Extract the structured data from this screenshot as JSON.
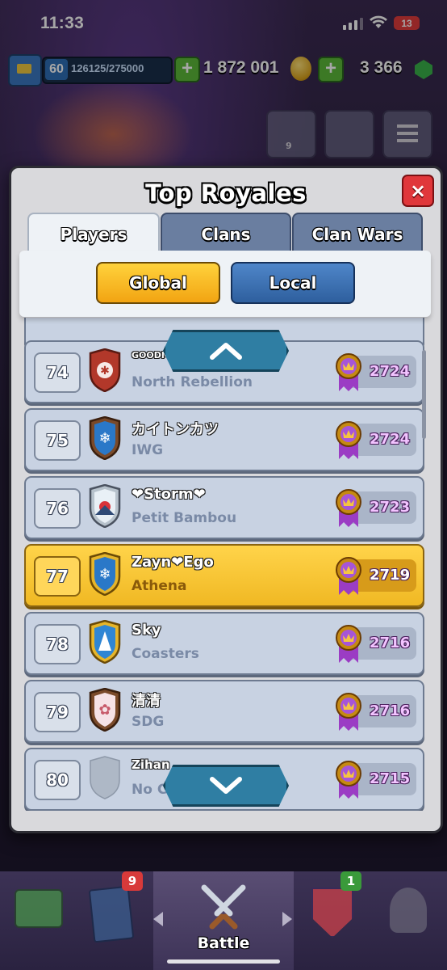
{
  "status_bar": {
    "time": "11:33",
    "battery": "13"
  },
  "resources": {
    "level": "60",
    "xp_progress": "126125/275000",
    "gold": "1 872 001",
    "gems": "3 366"
  },
  "menu": {
    "friends_count": "9"
  },
  "modal": {
    "title": "Top Royales",
    "close_label": "×",
    "tabs": [
      {
        "label": "Players",
        "active": true
      },
      {
        "label": "Clans",
        "active": false
      },
      {
        "label": "Clan Wars",
        "active": false
      }
    ],
    "toggles": {
      "global": "Global",
      "local": "Local",
      "selected": "Global"
    },
    "scroll_up": "⌃",
    "scroll_down": "⌄"
  },
  "leaderboard": [
    {
      "rank": "74",
      "name": "GOODM...",
      "clan": "North Rebellion",
      "trophies": "2724",
      "badge_color": "#b2382a",
      "self": false
    },
    {
      "rank": "75",
      "name": "カイトンカツ",
      "clan": "IWG",
      "trophies": "2724",
      "badge_color": "#2a78c8",
      "self": false
    },
    {
      "rank": "76",
      "name": "❤Storm❤",
      "clan": "Petit Bambou",
      "trophies": "2723",
      "badge_color": "#b7c2cc",
      "self": false
    },
    {
      "rank": "77",
      "name": "Zayn❤Ego",
      "clan": "Athena",
      "trophies": "2719",
      "badge_color": "#2a78c8",
      "self": true
    },
    {
      "rank": "78",
      "name": "Sky",
      "clan": "Coasters",
      "trophies": "2716",
      "badge_color": "#2f86d4",
      "self": false
    },
    {
      "rank": "79",
      "name": "清清",
      "clan": "SDG",
      "trophies": "2716",
      "badge_color": "#c85a6a",
      "self": false
    },
    {
      "rank": "80",
      "name": "Zihan",
      "clan": "No Cl...",
      "trophies": "2715",
      "badge_color": "#aeb8c6",
      "self": false
    }
  ],
  "bottom_nav": {
    "shop_badge": "",
    "cards_badge": "9",
    "battle_label": "Battle",
    "clan_badge": "1"
  }
}
